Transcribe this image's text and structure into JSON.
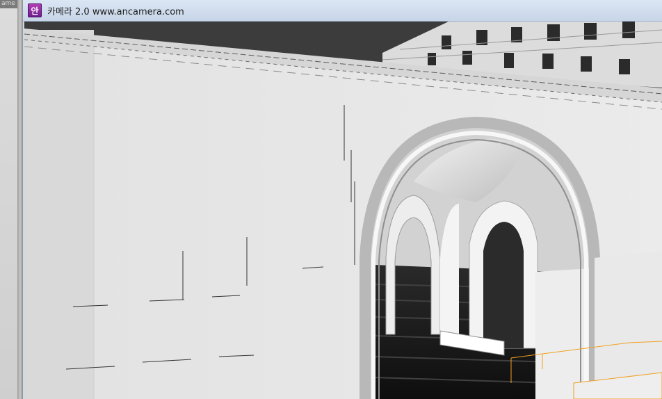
{
  "background_app": {
    "viewport_label": "ame"
  },
  "window": {
    "app_icon_glyph": "안",
    "title": "카메라 2.0 www.ancamera.com"
  },
  "viewport": {
    "content": "3d-architectural-render"
  },
  "colors": {
    "titlebar": "#c7d5e8",
    "wall": "#e6e6e6",
    "floor": "#1a1a1a",
    "selection": "#f0a020"
  }
}
